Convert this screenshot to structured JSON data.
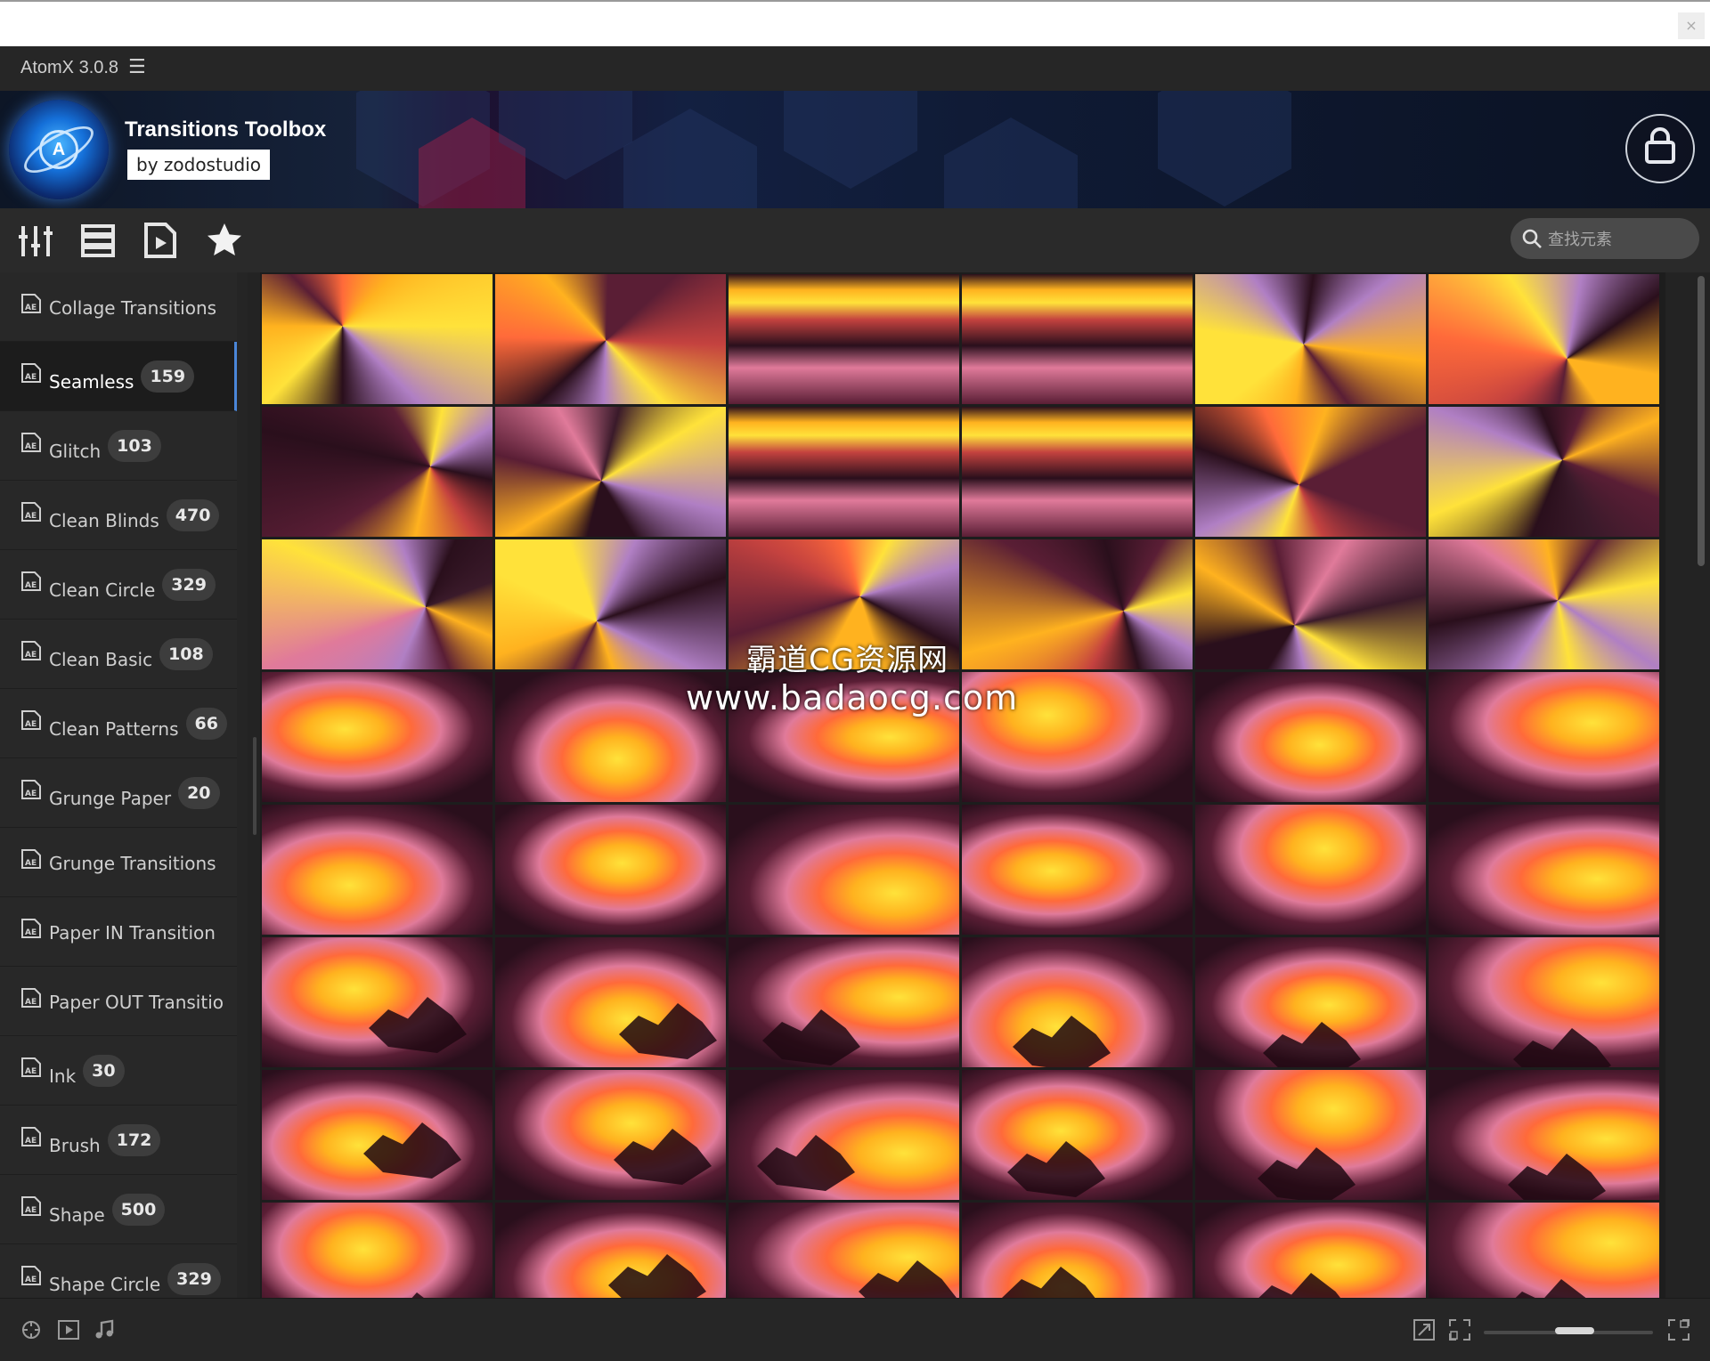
{
  "window": {
    "close_label": "×"
  },
  "app": {
    "title": "AtomX 3.0.8",
    "menu_icon": "hamburger-icon"
  },
  "banner": {
    "title": "Transitions Toolbox",
    "by": "by zodostudio",
    "logo_letter": "A",
    "cart_icon": "shopping-bag-icon"
  },
  "toolbar": {
    "icons": [
      "sliders-icon",
      "list-icon",
      "video-file-icon",
      "star-icon"
    ],
    "search": {
      "placeholder": "查找元素",
      "value": ""
    }
  },
  "sidebar": {
    "items": [
      {
        "label": "Collage Transitions",
        "count": "",
        "active": false
      },
      {
        "label": "Seamless",
        "count": "159",
        "active": true
      },
      {
        "label": "Glitch",
        "count": "103",
        "active": false
      },
      {
        "label": "Clean Blinds",
        "count": "470",
        "active": false
      },
      {
        "label": "Clean Circle",
        "count": "329",
        "active": false
      },
      {
        "label": "Clean Basic",
        "count": "108",
        "active": false
      },
      {
        "label": "Clean Patterns",
        "count": "66",
        "active": false
      },
      {
        "label": "Grunge Paper",
        "count": "20",
        "active": false
      },
      {
        "label": "Grunge Transitions",
        "count": "",
        "active": false
      },
      {
        "label": "Paper IN Transition",
        "count": "",
        "active": false
      },
      {
        "label": "Paper OUT Transitio",
        "count": "",
        "active": false
      },
      {
        "label": "Ink",
        "count": "30",
        "active": false
      },
      {
        "label": "Brush",
        "count": "172",
        "active": false
      },
      {
        "label": "Shape",
        "count": "500",
        "active": false
      },
      {
        "label": "Shape Circle",
        "count": "329",
        "active": false
      }
    ]
  },
  "grid": {
    "columns": 6,
    "rows": 8,
    "palette": [
      "#2a0f1c",
      "#5a1e35",
      "#c4423f",
      "#ff6a3a",
      "#ffb21f",
      "#ffe23a",
      "#b07fc4",
      "#e07a9a",
      "#3a1a2a"
    ]
  },
  "watermark": {
    "line1": "霸道CG资源网",
    "line2": "www.badaocg.com"
  },
  "bottom_bar": {
    "left_icons": [
      "gamepad-icon",
      "play-box-icon",
      "music-note-icon"
    ],
    "right_icons": [
      "export-icon",
      "fit-icon",
      "fullscreen-icon"
    ],
    "zoom_level": 0.55
  }
}
